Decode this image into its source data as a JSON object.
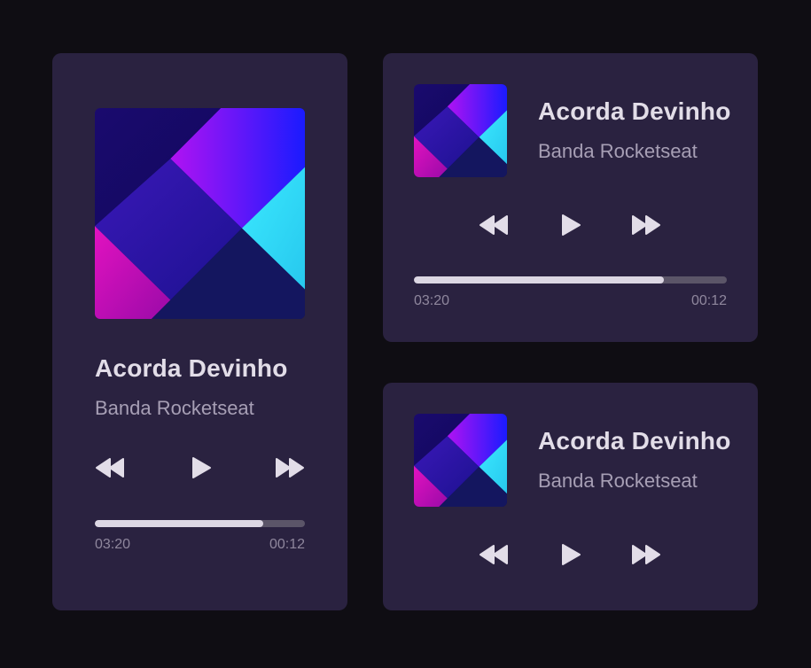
{
  "colors": {
    "background": "#0f0d13",
    "card": "#2a2240",
    "title": "#e2dde8",
    "artist": "#a79fb5",
    "progress_fill": "#dcd7e3",
    "progress_track": "#5b5568"
  },
  "players": [
    {
      "variant": "large",
      "title": "Acorda Devinho",
      "artist": "Banda Rocketseat",
      "cover": "album-cover-art",
      "controls": {
        "previous": "rewind-icon",
        "play": "play-icon",
        "next": "fast-forward-icon"
      },
      "elapsed": "03:20",
      "remaining": "00:12",
      "progress": 0.8
    },
    {
      "variant": "medium",
      "title": "Acorda Devinho",
      "artist": "Banda Rocketseat",
      "cover": "album-cover-art",
      "controls": {
        "previous": "rewind-icon",
        "play": "play-icon",
        "next": "fast-forward-icon"
      },
      "elapsed": "03:20",
      "remaining": "00:12",
      "progress": 0.8
    },
    {
      "variant": "small",
      "title": "Acorda Devinho",
      "artist": "Banda Rocketseat",
      "cover": "album-cover-art",
      "controls": {
        "previous": "rewind-icon",
        "play": "play-icon",
        "next": "fast-forward-icon"
      }
    }
  ]
}
